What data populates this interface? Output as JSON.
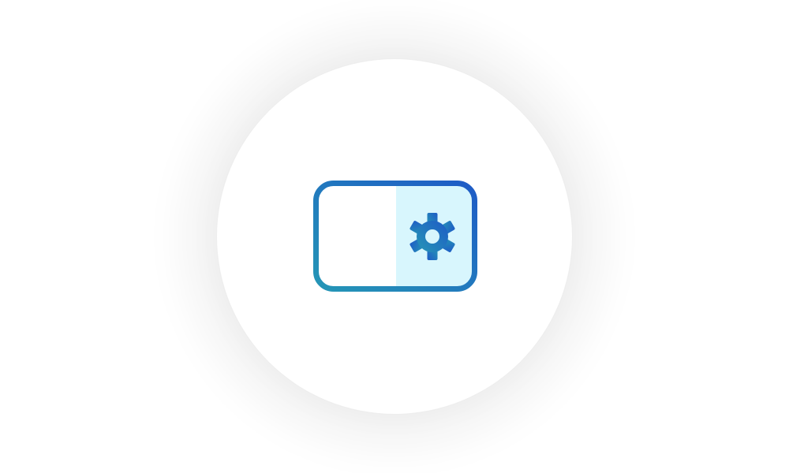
{
  "icon": {
    "name": "settings-panel-icon",
    "gradient": {
      "start": "#2596B6",
      "end": "#1E5BC6"
    },
    "right_panel_fill": "#D8F6FD",
    "left_panel_fill": "#FFFFFF"
  },
  "background": {
    "page": "#FFFFFF",
    "circle": "#FFFFFF"
  }
}
